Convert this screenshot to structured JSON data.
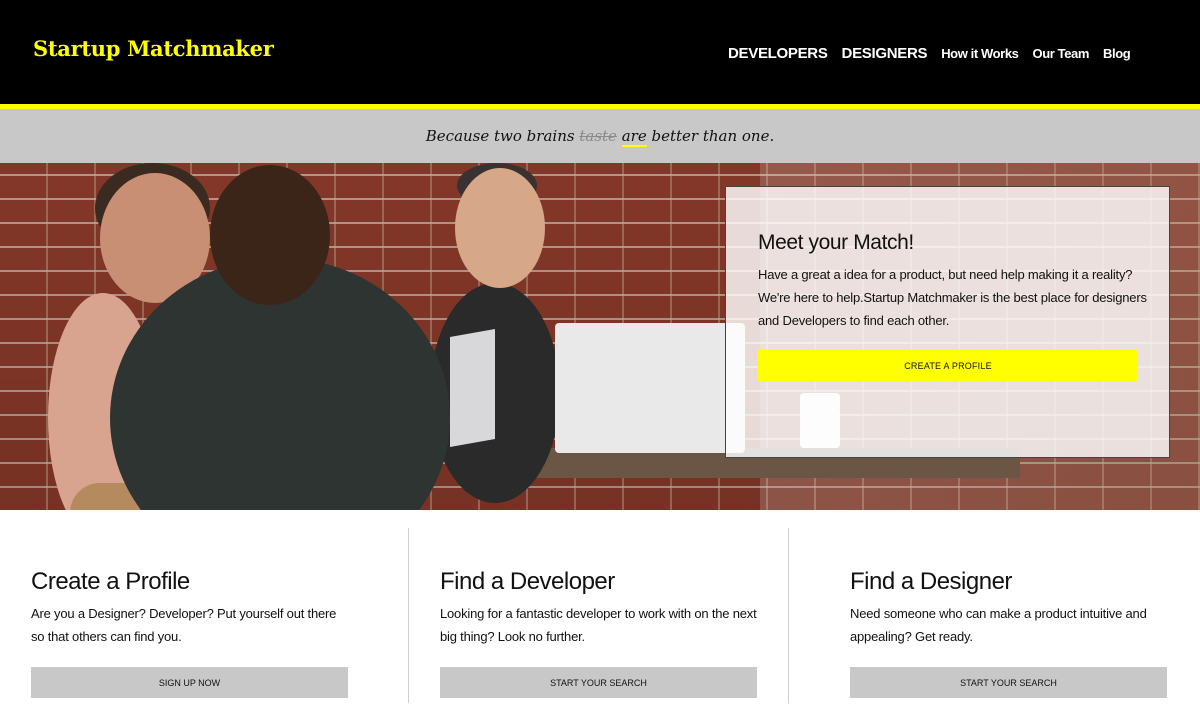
{
  "header": {
    "logo": "Startup Matchmaker",
    "nav": [
      {
        "label": "DEVELOPERS"
      },
      {
        "label": "DESIGNERS"
      },
      {
        "label": "How it Works"
      },
      {
        "label": "Our Team"
      },
      {
        "label": "Blog"
      }
    ]
  },
  "tagline": {
    "prefix": "Because two brains",
    "struck": "taste",
    "highlight": "are",
    "suffix": "better than one."
  },
  "hero": {
    "title": "Meet your Match!",
    "text": "Have a great a idea for a product, but need help making it a reality? We're here to help.Startup Matchmaker is the best place for designers and Developers to find each other.",
    "cta": "CREATE A PROFILE"
  },
  "cards": [
    {
      "title": "Create a Profile",
      "text": "Are you a Designer? Developer? Put yourself out there so that others can find you.",
      "button": "SIGN UP NOW"
    },
    {
      "title": "Find a Developer",
      "text": "Looking for a fantastic developer to work with on the next big thing? Look no further.",
      "button": "START YOUR SEARCH"
    },
    {
      "title": "Find a Designer",
      "text": "Need someone who can make a product intuitive and appealing? Get ready.",
      "button": "START YOUR SEARCH"
    }
  ],
  "colors": {
    "accent": "#ffff00",
    "header_bg": "#000000",
    "tagline_bg": "#c8c8c8",
    "button_gray": "#c8c8c8"
  }
}
